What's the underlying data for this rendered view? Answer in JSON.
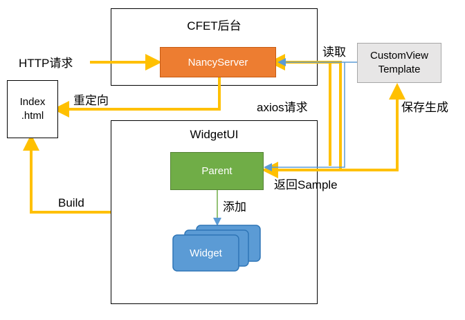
{
  "backend_frame": {
    "title": "CFET后台"
  },
  "widgetui_frame": {
    "title": "WidgetUI"
  },
  "nodes": {
    "nancy_server": "NancyServer",
    "custom_view_template_line1": "CustomView",
    "custom_view_template_line2": "Template",
    "index_html_line1": "Index",
    "index_html_line2": ".html",
    "parent": "Parent",
    "widget": "Widget"
  },
  "edge_labels": {
    "http_request": "HTTP请求",
    "redirect": "重定向",
    "read": "读取",
    "axios_request": "axios请求",
    "save_generate": "保存生成",
    "return_sample": "返回Sample",
    "build": "Build",
    "add": "添加"
  },
  "colors": {
    "arrow_yellow": "#FFC000",
    "arrow_blue": "#5B9BD5",
    "nancy_fill": "#ED7D31",
    "parent_fill": "#70AD47",
    "widget_fill": "#5B9BD5",
    "template_fill": "#E7E6E6"
  }
}
